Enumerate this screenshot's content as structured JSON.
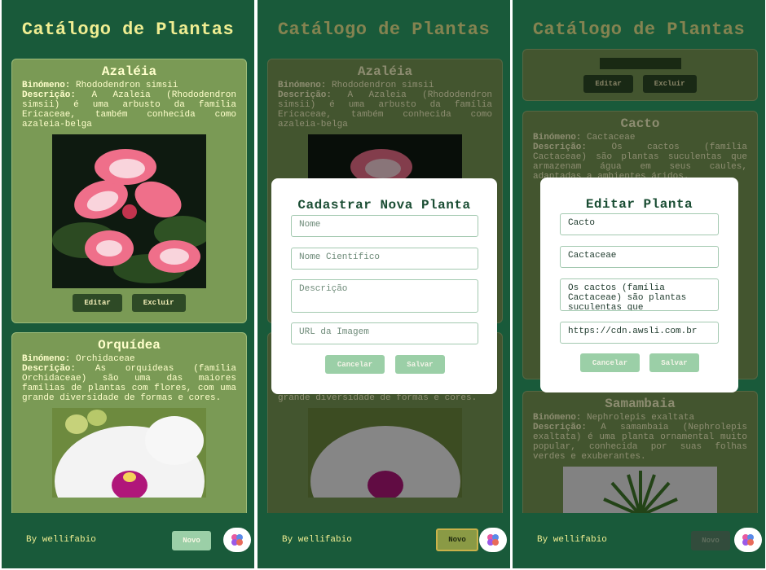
{
  "app": {
    "title": "Catálogo de Plantas",
    "credit": "By wellifabio",
    "new_label": "Novo"
  },
  "plants": [
    {
      "name": "Azaléia",
      "binomial_label": "Binómeno:",
      "binomial": "Rhododendron simsii",
      "desc_label": "Descrição:",
      "desc": "A Azaleia (Rhododendron simsii) é uma arbusto da família Ericaceae, também conhecida como azaleia-belga"
    },
    {
      "name": "Orquídea",
      "binomial_label": "Binómeno:",
      "binomial": "Orchidaceae",
      "desc_label": "Descrição:",
      "desc": "As orquideas (família Orchidaceae) são uma das maiores famílias de plantas com flores, com uma grande diversidade de formas e cores."
    },
    {
      "name": "Cacto",
      "binomial_label": "Binómeno:",
      "binomial": "Cactaceae",
      "desc_label": "Descrição:",
      "desc": "Os cactos (família Cactaceae) são plantas suculentas que armazenam água em seus caules, adaptadas a ambientes áridos."
    },
    {
      "name": "Samambaia",
      "binomial_label": "Binómeno:",
      "binomial": "Nephrolepis exaltata",
      "desc_label": "Descrição:",
      "desc": "A samambaia (Nephrolepis exaltata) é uma planta ornamental muito popular, conhecida por suas folhas verdes e exuberantes."
    }
  ],
  "card_actions": {
    "edit": "Editar",
    "delete": "Excluir"
  },
  "create_modal": {
    "title": "Cadastrar Nova Planta",
    "name_placeholder": "Nome",
    "sci_placeholder": "Nome Científico",
    "desc_placeholder": "Descrição",
    "img_placeholder": "URL da Imagem",
    "cancel": "Cancelar",
    "save": "Salvar"
  },
  "edit_modal": {
    "title": "Editar Planta",
    "name_value": "Cacto",
    "sci_value": "Cactaceae",
    "desc_value": "Os cactos (família Cactaceae) são plantas suculentas que",
    "img_value": "https://cdn.awsli.com.br",
    "cancel": "Cancelar",
    "save": "Salvar"
  },
  "colors": {
    "background": "#195a3a",
    "card": "#7a9a55",
    "title": "#f0ee92",
    "accent": "#9bcfa7"
  }
}
